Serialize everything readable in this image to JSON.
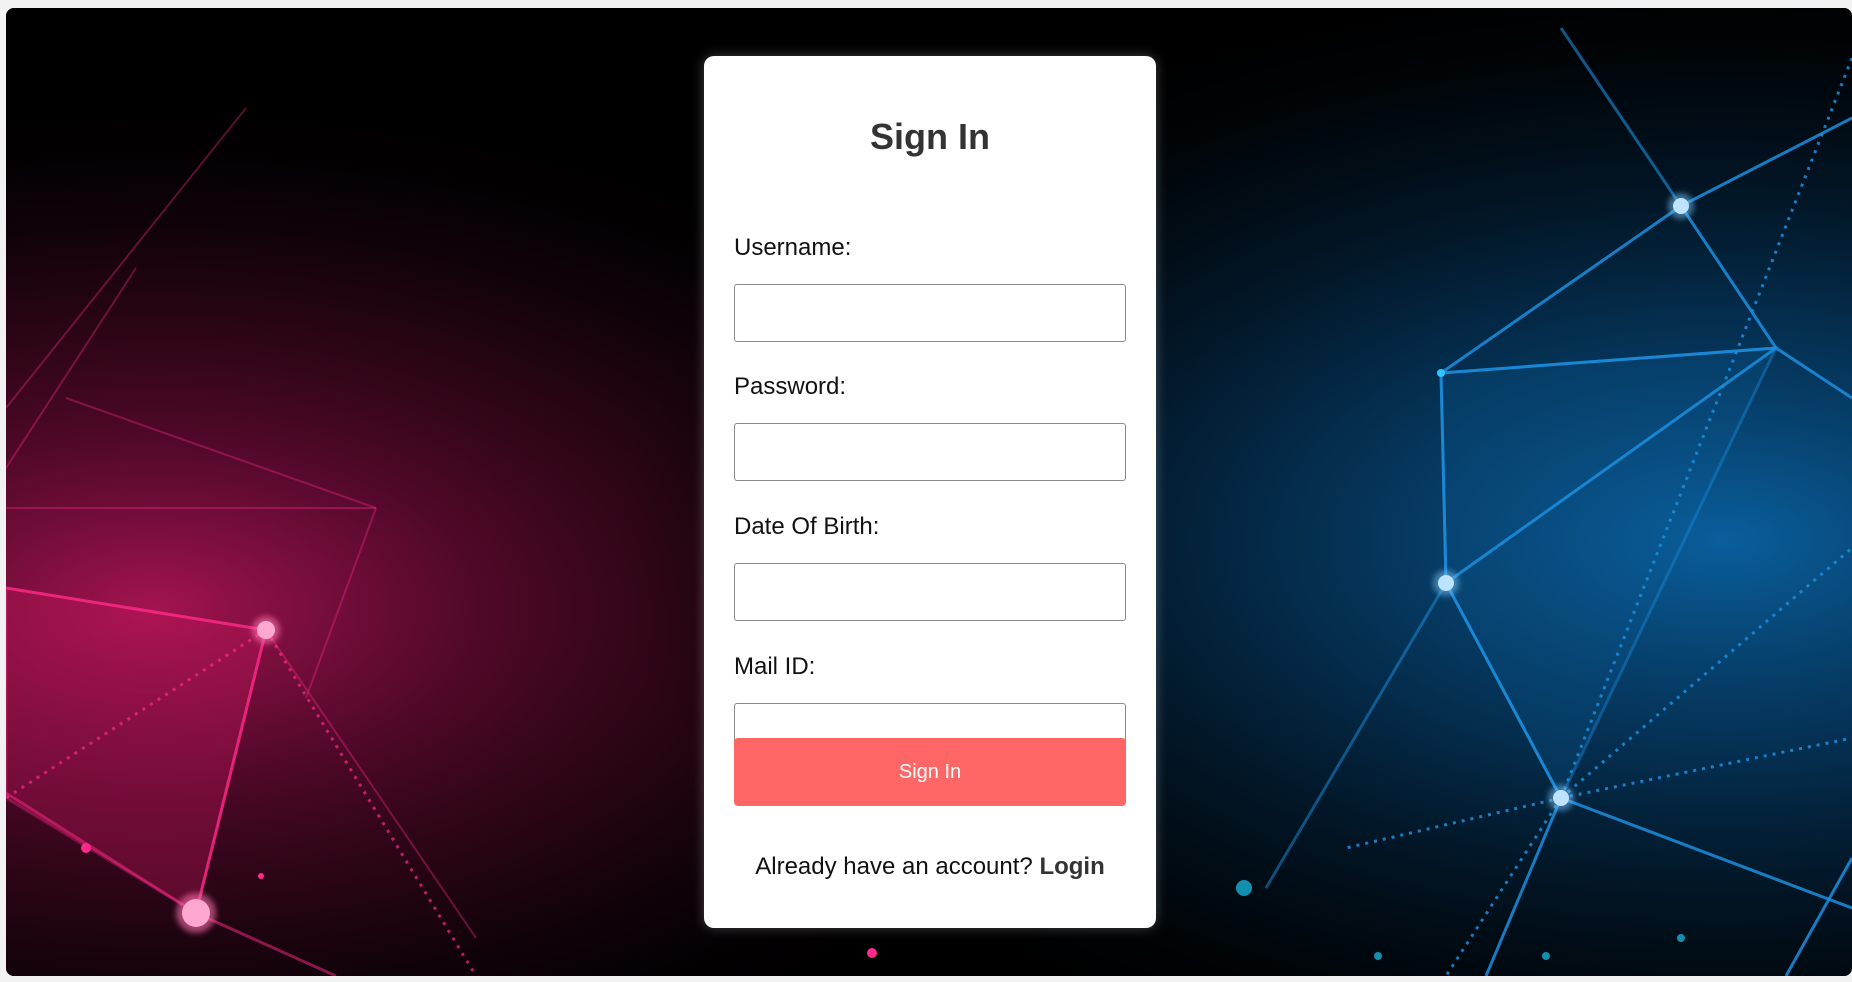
{
  "form": {
    "title": "Sign In",
    "fields": [
      {
        "label": "Username:",
        "value": "",
        "placeholder": ""
      },
      {
        "label": "Password:",
        "value": "",
        "placeholder": ""
      },
      {
        "label": "Date Of Birth:",
        "value": "",
        "placeholder": ""
      },
      {
        "label": "Mail ID:",
        "value": "",
        "placeholder": ""
      }
    ],
    "submit_label": "Sign In",
    "footer_text": "Already have an account?",
    "login_link": "Login"
  },
  "colors": {
    "button": "#ff6666",
    "title": "#333333",
    "background_left_glow": "#ff1a7a",
    "background_right_glow": "#1aa3ff"
  }
}
